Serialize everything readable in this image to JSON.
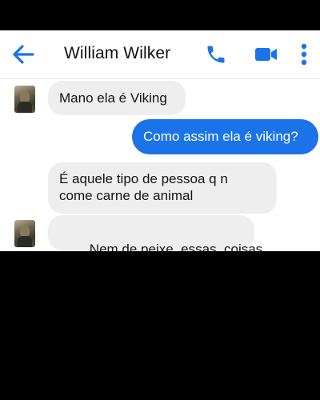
{
  "header": {
    "contact_name": "William Wilker",
    "back_icon": "arrow-left-icon",
    "call_icon": "phone-icon",
    "video_icon": "video-camera-icon",
    "more_icon": "more-vertical-icon",
    "accent_color": "#1a73e8"
  },
  "messages": [
    {
      "direction": "incoming",
      "show_avatar": true,
      "lines": [
        "Mano ela é Viking"
      ]
    },
    {
      "direction": "outgoing",
      "show_avatar": false,
      "lines": [
        "Como assim ela é viking?"
      ]
    },
    {
      "direction": "incoming",
      "show_avatar": false,
      "lines": [
        "É aquele tipo de pessoa q n",
        "come carne de animal"
      ]
    },
    {
      "direction": "incoming",
      "show_avatar": true,
      "lines": [
        "Nem de peixe, essas  coisas"
      ]
    }
  ],
  "colors": {
    "incoming_bubble": "#eeeeef",
    "outgoing_bubble": "#1a73e8",
    "letterbox": "#000000"
  }
}
